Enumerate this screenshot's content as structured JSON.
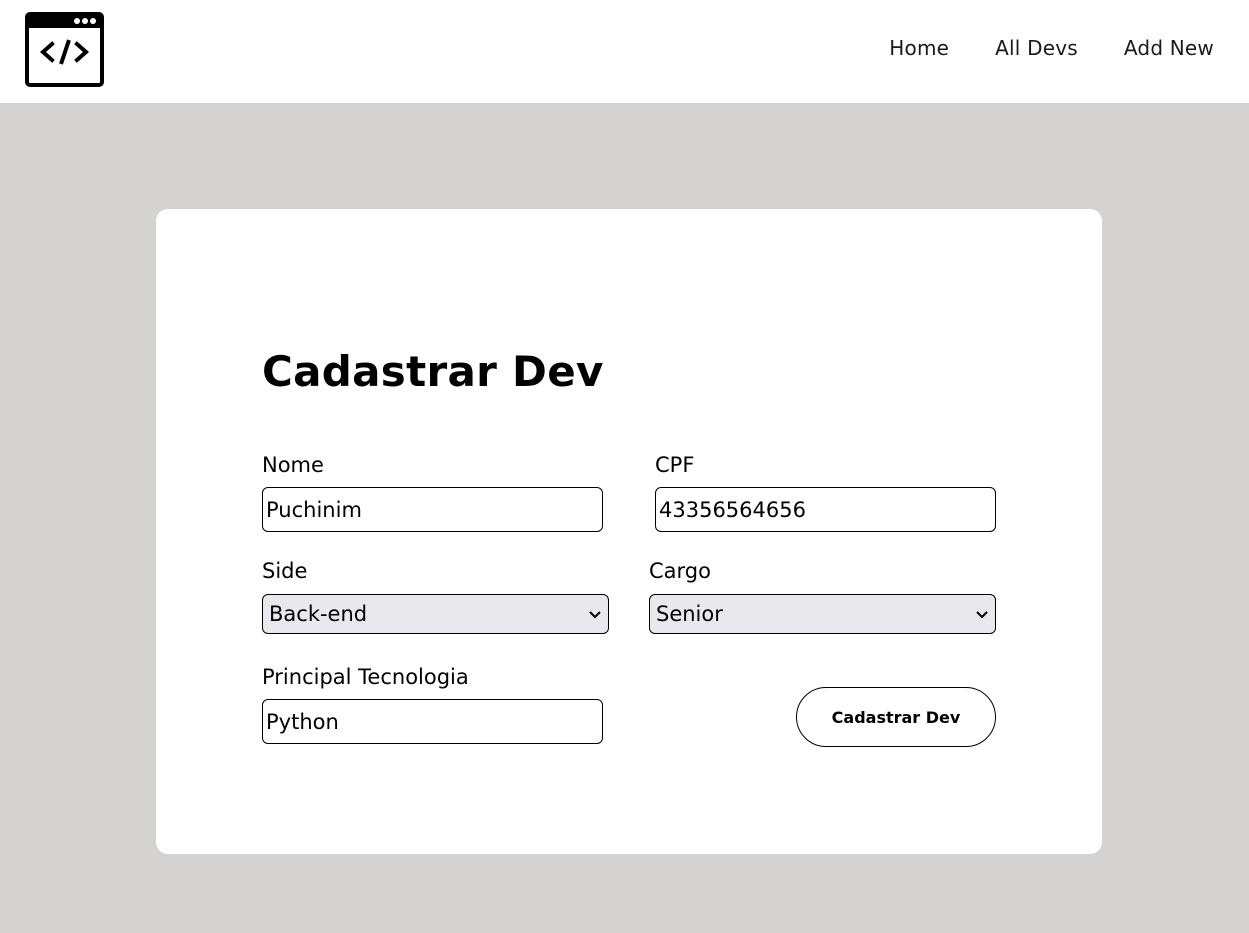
{
  "nav": {
    "logo_icon": "code-window-icon",
    "items": [
      {
        "label": "Home"
      },
      {
        "label": "All Devs"
      },
      {
        "label": "Add New"
      }
    ]
  },
  "form": {
    "title": "Cadastrar Dev",
    "nome": {
      "label": "Nome",
      "value": "Puchinim"
    },
    "cpf": {
      "label": "CPF",
      "value": "43356564656"
    },
    "side": {
      "label": "Side",
      "value": "Back-end"
    },
    "cargo": {
      "label": "Cargo",
      "value": "Senior"
    },
    "tecnologia": {
      "label": "Principal Tecnologia",
      "value": "Python"
    },
    "submit_label": "Cadastrar Dev"
  }
}
